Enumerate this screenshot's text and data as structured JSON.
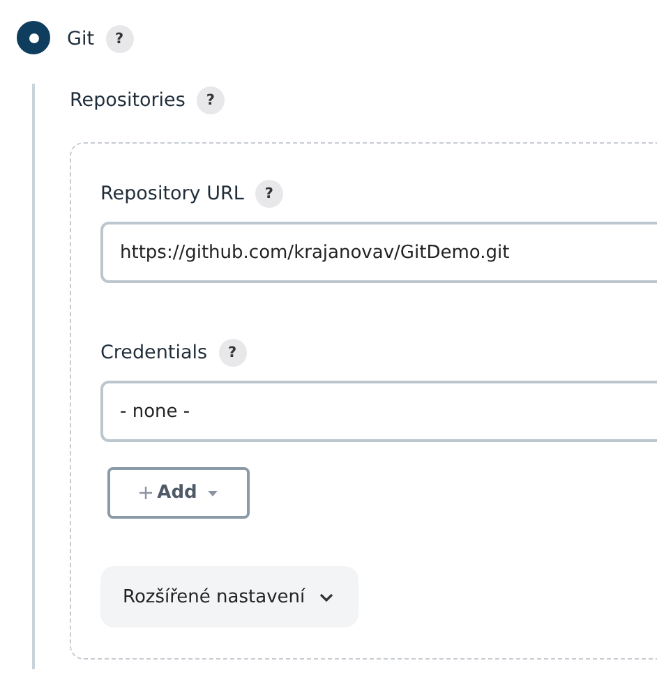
{
  "scm_option": {
    "label": "Git",
    "selected": true,
    "help": "?"
  },
  "repositories": {
    "label": "Repositories",
    "help": "?",
    "fields": [
      {
        "label": "Repository URL",
        "help": "?",
        "value": "https://github.com/krajanovav/GitDemo.git"
      },
      {
        "label": "Credentials",
        "help": "?",
        "value": "- none -"
      }
    ],
    "add_button": {
      "label": "Add"
    },
    "advanced_button": {
      "label": "Rozšířené nastavení"
    }
  }
}
